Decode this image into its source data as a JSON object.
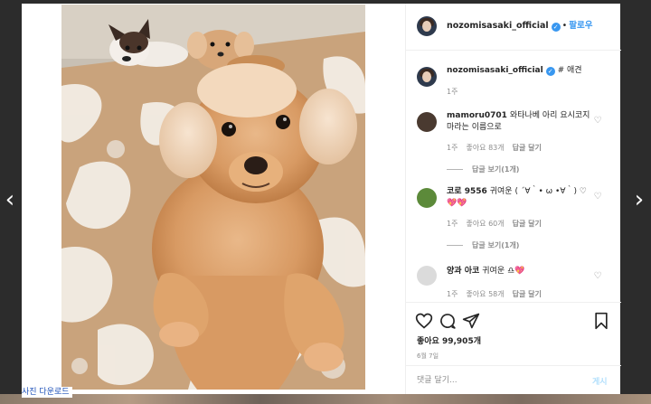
{
  "post": {
    "username": "nozomisasaki_official",
    "follow_label": "팔로우",
    "dot": "•",
    "verified_mark": "✓",
    "photo_download_label": "사진 다운로드",
    "caption": {
      "username": "nozomisasaki_official",
      "text": "# 애견",
      "time": "1주"
    }
  },
  "comments": [
    {
      "username": "mamoru0701",
      "text": "와타나베 아리 요시코지마라는 이름으로",
      "time": "1주",
      "likes": "좋아요 83개",
      "reply_label": "답글 달기",
      "view_replies": "답글 보기(1개)",
      "avatar_color": "#4a3a30"
    },
    {
      "username": "코로 9556",
      "text": "귀여운 ( ´∀｀• ω •∀｀) ♡💖💖",
      "time": "1주",
      "likes": "좋아요 60개",
      "reply_label": "답글 달기",
      "view_replies": "답글 보기(1개)",
      "avatar_color": "#5c8a3a"
    },
    {
      "username": "양과 아코",
      "text": "귀여운 ♎💖",
      "time": "1주",
      "likes": "좋아요 58개",
      "reply_label": "답글 달기",
      "view_replies": "",
      "avatar_color": "#dbdbdb"
    }
  ],
  "actions": {
    "likes": "좋아요 99,905개",
    "date": "6월 7일",
    "icons": [
      "heart-icon",
      "comment-icon",
      "share-icon",
      "bookmark-icon"
    ]
  },
  "comment_box": {
    "placeholder": "댓글 달기...",
    "post_label": "게시"
  },
  "navigation": {
    "prev": "‹",
    "next": "›"
  },
  "colors": {
    "accent": "#3897f0",
    "muted": "#8e8e8e",
    "border": "#efefef",
    "backdrop": "#2c2c2c"
  }
}
